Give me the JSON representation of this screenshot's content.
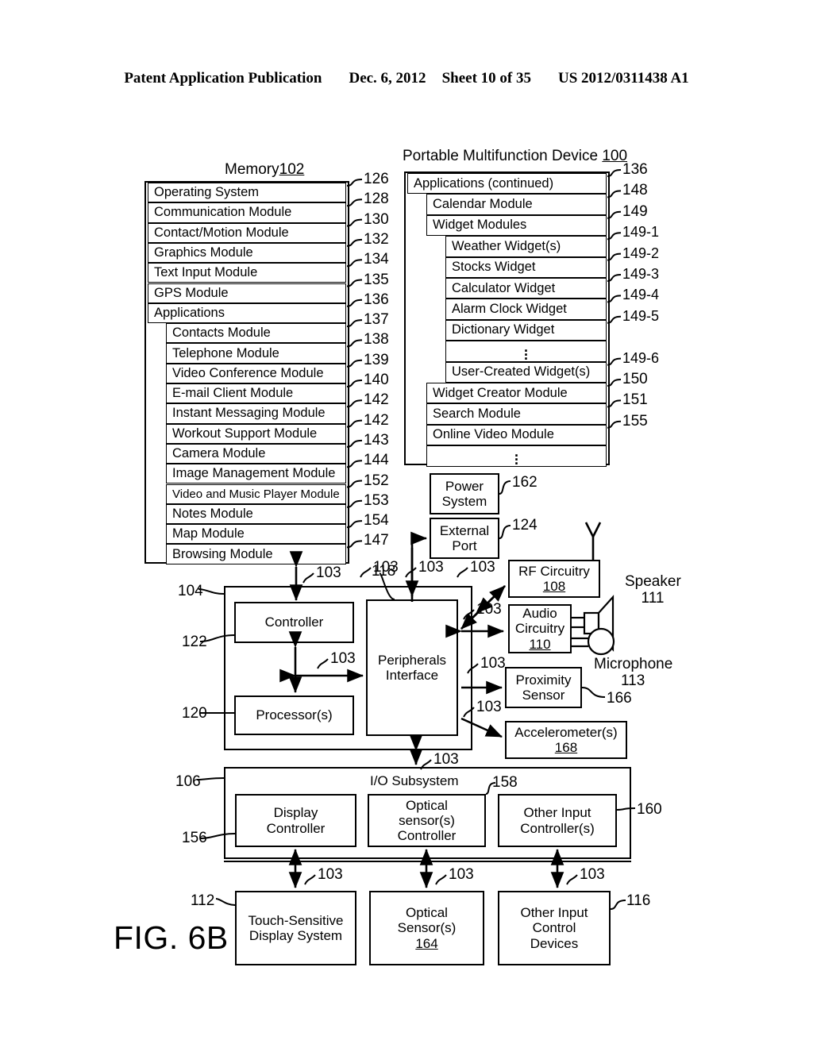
{
  "header": {
    "publication": "Patent Application Publication",
    "date": "Dec. 6, 2012",
    "sheet": "Sheet 10 of 35",
    "number": "US 2012/0311438 A1"
  },
  "figure": {
    "caption": "FIG. 6B",
    "device_title": "Portable Multifunction Device ",
    "device_ref": "100",
    "memory_title": "Memory",
    "memory_ref": "102"
  },
  "memory_block": {
    "rows": [
      {
        "label": "Operating System",
        "ref": "126",
        "indent": 0
      },
      {
        "label": "Communication Module",
        "ref": "128",
        "indent": 0
      },
      {
        "label": "Contact/Motion Module",
        "ref": "130",
        "indent": 0
      },
      {
        "label": "Graphics Module",
        "ref": "132",
        "indent": 0
      },
      {
        "label": "Text Input Module",
        "ref": "134",
        "indent": 0
      },
      {
        "label": "GPS Module",
        "ref": "135",
        "indent": 0
      },
      {
        "label": "Applications",
        "ref": "136",
        "indent": 0
      },
      {
        "label": "Contacts Module",
        "ref": "137",
        "indent": 1
      },
      {
        "label": "Telephone Module",
        "ref": "138",
        "indent": 1
      },
      {
        "label": "Video Conference Module",
        "ref": "139",
        "indent": 1
      },
      {
        "label": "E-mail Client Module",
        "ref": "140",
        "indent": 1
      },
      {
        "label": "Instant Messaging Module",
        "ref": "142",
        "indent": 1
      },
      {
        "label": "Workout Support Module",
        "ref": "142",
        "indent": 1
      },
      {
        "label": "Camera Module",
        "ref": "143",
        "indent": 1
      },
      {
        "label": "Image Management Module",
        "ref": "144",
        "indent": 1
      },
      {
        "label": "Video and Music Player Module",
        "ref": "152",
        "indent": 1,
        "small": true
      },
      {
        "label": "Notes Module",
        "ref": "153",
        "indent": 1
      },
      {
        "label": "Map Module",
        "ref": "154",
        "indent": 1
      },
      {
        "label": "Browsing Module",
        "ref": "147",
        "indent": 1
      }
    ]
  },
  "applications_block": {
    "rows": [
      {
        "label": "Applications (continued)",
        "ref": "136",
        "indent": 0
      },
      {
        "label": "Calendar Module",
        "ref": "148",
        "indent": 1
      },
      {
        "label": "Widget Modules",
        "ref": "149",
        "indent": 1
      },
      {
        "label": "Weather Widget(s)",
        "ref": "149-1",
        "indent": 2
      },
      {
        "label": "Stocks Widget",
        "ref": "149-2",
        "indent": 2
      },
      {
        "label": "Calculator Widget",
        "ref": "149-3",
        "indent": 2
      },
      {
        "label": "Alarm Clock Widget",
        "ref": "149-4",
        "indent": 2
      },
      {
        "label": "Dictionary Widget",
        "ref": "149-5",
        "indent": 2
      },
      {
        "label": "",
        "ref": "",
        "indent": 2,
        "ellipsis": true
      },
      {
        "label": "User-Created Widget(s)",
        "ref": "149-6",
        "indent": 2
      },
      {
        "label": "Widget Creator Module",
        "ref": "150",
        "indent": 1
      },
      {
        "label": "Search Module",
        "ref": "151",
        "indent": 1
      },
      {
        "label": "Online Video Module",
        "ref": "155",
        "indent": 1
      },
      {
        "label": "",
        "ref": "",
        "indent": 1,
        "ellipsis": true
      }
    ]
  },
  "blocks": {
    "power_system": {
      "label": "Power\nSystem",
      "ref": "162"
    },
    "external_port": {
      "label": "External\nPort",
      "ref": "124"
    },
    "rf_circuitry": {
      "label": "RF Circuitry",
      "ref_in": "108"
    },
    "audio_circuitry": {
      "label": "Audio\nCircuitry",
      "ref_in": "110"
    },
    "proximity_sensor": {
      "label": "Proximity\nSensor",
      "ref": "166"
    },
    "accelerometer": {
      "label": "Accelerometer(s)",
      "ref_in": "168"
    },
    "controller": {
      "label": "Controller",
      "ref": "122"
    },
    "processors": {
      "label": "Processor(s)",
      "ref": "120"
    },
    "peripherals_interface": {
      "label": "Peripherals\nInterface",
      "ref": "118"
    },
    "cpu_group": {
      "ref": "104"
    },
    "io_subsystem": {
      "label": "I/O Subsystem",
      "ref": "106"
    },
    "display_controller": {
      "label": "Display\nController",
      "ref": "156"
    },
    "optical_sensor_controller": {
      "label": "Optical\nsensor(s)\nController",
      "ref": "158"
    },
    "other_input_controllers": {
      "label": "Other Input\nController(s)",
      "ref": "160"
    },
    "touch_display": {
      "label": "Touch-Sensitive\nDisplay System",
      "ref": "112"
    },
    "optical_sensors": {
      "label": "Optical\nSensor(s)",
      "ref_in": "164"
    },
    "other_input_devices": {
      "label": "Other Input\nControl\nDevices",
      "ref": "116"
    }
  },
  "peripherals": {
    "speaker_label": "Speaker",
    "speaker_ref": "111",
    "microphone_label": "Microphone",
    "microphone_ref": "113"
  },
  "bus_ref": "103",
  "bus_refs": {
    "memory_to_cpu": "103",
    "ext_port": "103",
    "rf": "103",
    "audio": "103",
    "proximity": "103",
    "accelerometer": "103",
    "ctrl_peripherals": "103",
    "peripherals_io": "103",
    "display": "103",
    "optical": "103",
    "other_input": "103",
    "peripherals_top": "103"
  }
}
